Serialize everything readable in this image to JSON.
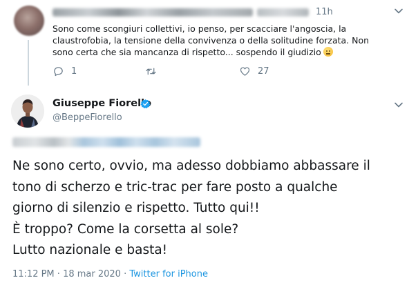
{
  "parent_tweet": {
    "time": "11h",
    "text": "Sono come scongiuri collettivi, io penso, per scacciare l'angoscia, la claustrofobia, la tensione della convivenza o della solitudine forzata. Non sono certa che sia mancanza di rispetto... sospendo il giudizio",
    "emoji": "neutral-face-emoji",
    "replies": "1",
    "retweets": "",
    "likes": "27"
  },
  "main_tweet": {
    "display_name": "Giuseppe Fiorello",
    "handle": "@BeppeFiorello",
    "text": "Ne sono certo, ovvio, ma adesso dobbiamo abbassare il\ntono di scherzo e tric-trac per fare posto a qualche\ngiorno di silenzio e rispetto. Tutto qui!!\nÈ troppo? Come la corsetta al sole?\nLutto nazionale e basta!",
    "time": "11:12 PM",
    "separator": "·",
    "date": "18 mar 2020",
    "source": "Twitter for iPhone"
  },
  "colors": {
    "text": "#14171a",
    "secondary": "#657786",
    "link": "#1b95e0",
    "verified": "#1da1f2"
  },
  "icons": [
    "chevron-down-icon",
    "reply-icon",
    "retweet-icon",
    "like-icon",
    "verified-badge-icon"
  ]
}
